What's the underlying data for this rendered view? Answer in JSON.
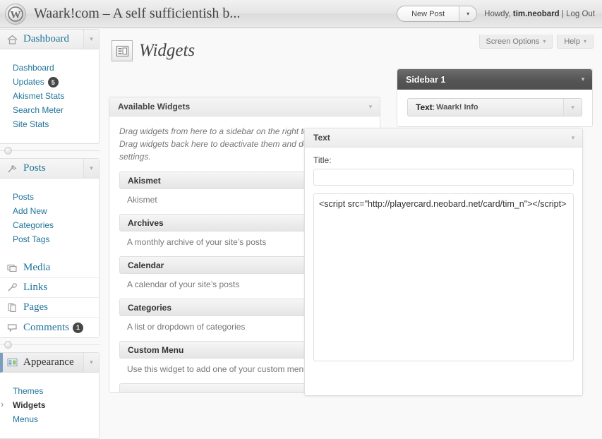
{
  "adminbar": {
    "logo_icon": "wordpress-logo-icon",
    "site_title": "Waark!com – A self sufficientish b...",
    "new_post_label": "New Post",
    "new_post_caret": "▾",
    "howdy_prefix": "Howdy,",
    "user_name": "tim.neobard",
    "separator": "|",
    "logout_label": "Log Out"
  },
  "screen_meta": {
    "screen_options_label": "Screen Options",
    "help_label": "Help",
    "caret": "▾"
  },
  "page": {
    "icon": "widgets-page-icon",
    "title": "Widgets"
  },
  "menu": [
    {
      "label": "Dashboard",
      "icon": "dashboard-icon",
      "has_arrow": true,
      "current": false,
      "submenu": [
        {
          "label": "Dashboard",
          "current": false
        },
        {
          "label": "Updates",
          "current": false,
          "badge": "5"
        },
        {
          "label": "Akismet Stats",
          "current": false
        },
        {
          "label": "Search Meter",
          "current": false
        },
        {
          "label": "Site Stats",
          "current": false
        }
      ]
    },
    {
      "label": "Posts",
      "icon": "posts-icon",
      "has_arrow": true,
      "current": false,
      "submenu": [
        {
          "label": "Posts",
          "current": false
        },
        {
          "label": "Add New",
          "current": false
        },
        {
          "label": "Categories",
          "current": false
        },
        {
          "label": "Post Tags",
          "current": false
        }
      ]
    },
    {
      "label": "Appearance",
      "icon": "appearance-icon",
      "has_arrow": true,
      "current": true,
      "submenu": [
        {
          "label": "Themes",
          "current": false
        },
        {
          "label": "Widgets",
          "current": true
        },
        {
          "label": "Menus",
          "current": false
        }
      ]
    }
  ],
  "menu_simple": [
    {
      "label": "Media",
      "icon": "media-icon"
    },
    {
      "label": "Links",
      "icon": "links-icon"
    },
    {
      "label": "Pages",
      "icon": "pages-icon"
    },
    {
      "label": "Comments",
      "icon": "comments-icon",
      "badge": "1"
    }
  ],
  "available_widgets": {
    "panel_title": "Available Widgets",
    "toggle_caret": "▾",
    "description": "Drag widgets from here to a sidebar on the right to activate them. Drag widgets back here to deactivate them and delete their settings.",
    "widgets": [
      {
        "name": "Akismet",
        "desc": "Akismet"
      },
      {
        "name": "Archives",
        "desc": "A monthly archive of your site’s posts"
      },
      {
        "name": "Calendar",
        "desc": "A calendar of your site’s posts"
      },
      {
        "name": "Categories",
        "desc": "A list or dropdown of categories"
      },
      {
        "name": "Custom Menu",
        "desc": "Use this widget to add one of your custom menus as a widget."
      }
    ]
  },
  "sidebar_panel": {
    "title": "Sidebar 1",
    "toggle_caret": "▾",
    "widgets": [
      {
        "type": "Text",
        "sep": ":",
        "name": "Waark! Info",
        "toggle_caret": "▾"
      }
    ]
  },
  "text_widget": {
    "panel_title": "Text",
    "toggle_caret": "▾",
    "title_label": "Title:",
    "title_value": "",
    "title_placeholder": "",
    "content": "<script src=\"http://playercard.neobard.net/card/tim_n\"></script>"
  },
  "colors": {
    "link": "#21759b",
    "dark_header": "#555555",
    "badge": "#464646",
    "page_bg": "#f9f9f9"
  }
}
